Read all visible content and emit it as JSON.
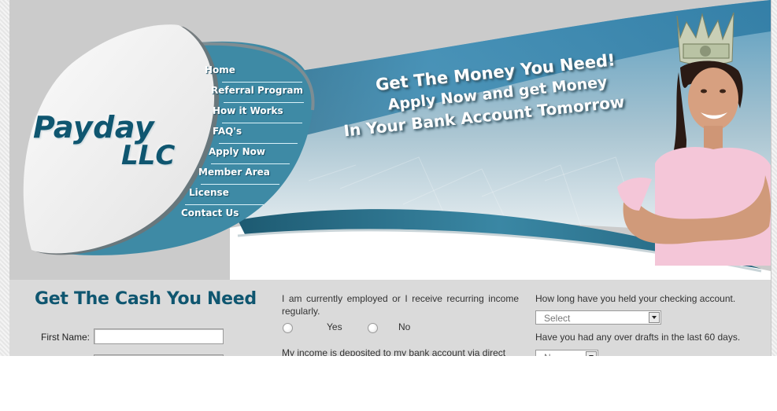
{
  "brand": {
    "name_line1": "Payday",
    "name_line2": "LLC",
    "color": "#0f5670",
    "accent": "#3c8aa6"
  },
  "nav": {
    "items": [
      {
        "label": "Home"
      },
      {
        "label": "Referral Program"
      },
      {
        "label": "How it Works"
      },
      {
        "label": "FAQ's"
      },
      {
        "label": "Apply Now"
      },
      {
        "label": "Member Area"
      },
      {
        "label": "License"
      },
      {
        "label": "Contact Us"
      }
    ]
  },
  "banner": {
    "headline": "Get The Money You Need!",
    "line2": "Apply Now and get Money",
    "line3": "In Your Bank Account Tomorrow"
  },
  "form": {
    "title": "Get The Cash You Need",
    "first_name_label": "First Name:",
    "first_name_value": "",
    "second_field_value": "",
    "employment_question": "I am currently employed or I receive recurring income regularly.",
    "employment_options": [
      {
        "label": "Yes",
        "checked": false
      },
      {
        "label": "No",
        "checked": false
      }
    ],
    "deposit_question": "My income is deposited to my bank account via direct",
    "checking_question": "How long have you held your checking account.",
    "checking_select_value": "Select",
    "overdraft_question": "Have you had any over drafts in the last 60 days.",
    "overdraft_select_value": "N"
  }
}
